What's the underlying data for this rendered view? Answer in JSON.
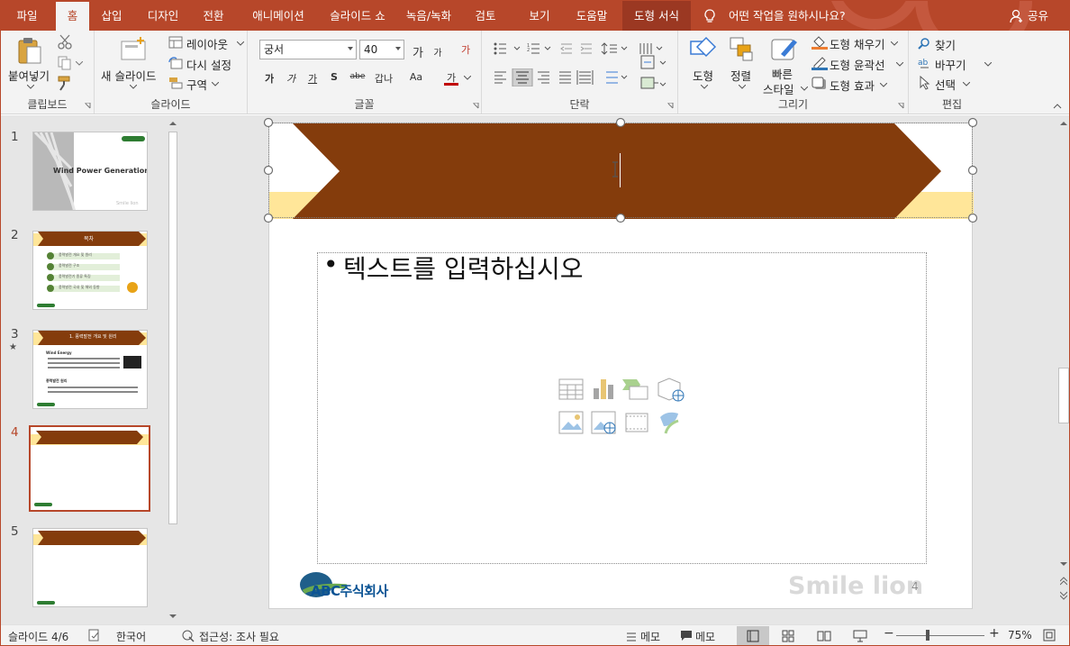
{
  "tabs": [
    "파일",
    "홈",
    "삽입",
    "디자인",
    "전환",
    "애니메이션",
    "슬라이드 쇼",
    "녹음/녹화",
    "검토",
    "보기",
    "도움말",
    "도형 서식"
  ],
  "tell_me": "어떤 작업을 원하시나요?",
  "share": "공유",
  "clipboard": {
    "paste": "붙여넣기",
    "group": "클립보드"
  },
  "slides_group": {
    "new_slide": "새 슬라이드",
    "layout": "레이아웃",
    "reset": "다시 설정",
    "section": "구역",
    "group": "슬라이드"
  },
  "font": {
    "name": "궁서",
    "size": "40",
    "grow": "가",
    "shrink": "가",
    "clear": "가",
    "bold": "가",
    "italic": "가",
    "underline": "가",
    "shadow": "S",
    "strike": "abe",
    "spacing": "갑나",
    "case": "Aa",
    "color": "가",
    "group": "글꼴"
  },
  "paragraph": {
    "group": "단락"
  },
  "drawing": {
    "shape": "도형",
    "arrange": "정렬",
    "quick_style_1": "빠른",
    "quick_style_2": "스타일",
    "fill": "도형 채우기",
    "outline": "도형 윤곽선",
    "effects": "도형 효과",
    "group": "그리기"
  },
  "editing": {
    "find": "찾기",
    "replace": "바꾸기",
    "select": "선택",
    "group": "편집"
  },
  "thumbnails": [
    {
      "num": "1",
      "title": "Wind Power Generation",
      "footer": "Smile lion"
    },
    {
      "num": "2",
      "title": "목차",
      "items": [
        "풍력발전 개요 및 원리",
        "풍력발전 구조",
        "풍력발전기 종류 특징",
        "풍력발전 국내 및 해외 동향"
      ]
    },
    {
      "num": "3",
      "star": "★",
      "title": "1. 풍력발전 개요 및 원리",
      "sub1": "Wind Energy",
      "sub2": "풍력발전 원리"
    },
    {
      "num": "4"
    },
    {
      "num": "5"
    }
  ],
  "slide": {
    "bullet": "•",
    "placeholder": "텍스트를 입력하십시오",
    "logo_text": "ABC주식회사",
    "footer_text": "Smile lion",
    "page_number": "4"
  },
  "status": {
    "slide_info": "슬라이드 4/6",
    "language": "한국어",
    "accessibility": "접근성: 조사 필요",
    "notes": "메모",
    "comments": "메모",
    "zoom_minus": "−",
    "zoom_plus": "+",
    "zoom": "75%",
    "zoom_level": 0.75
  },
  "colors": {
    "accent": "#b7472a",
    "banner": "#843c0c",
    "banner_light": "#ffe699",
    "pane_bg": "#e6e6e6"
  }
}
